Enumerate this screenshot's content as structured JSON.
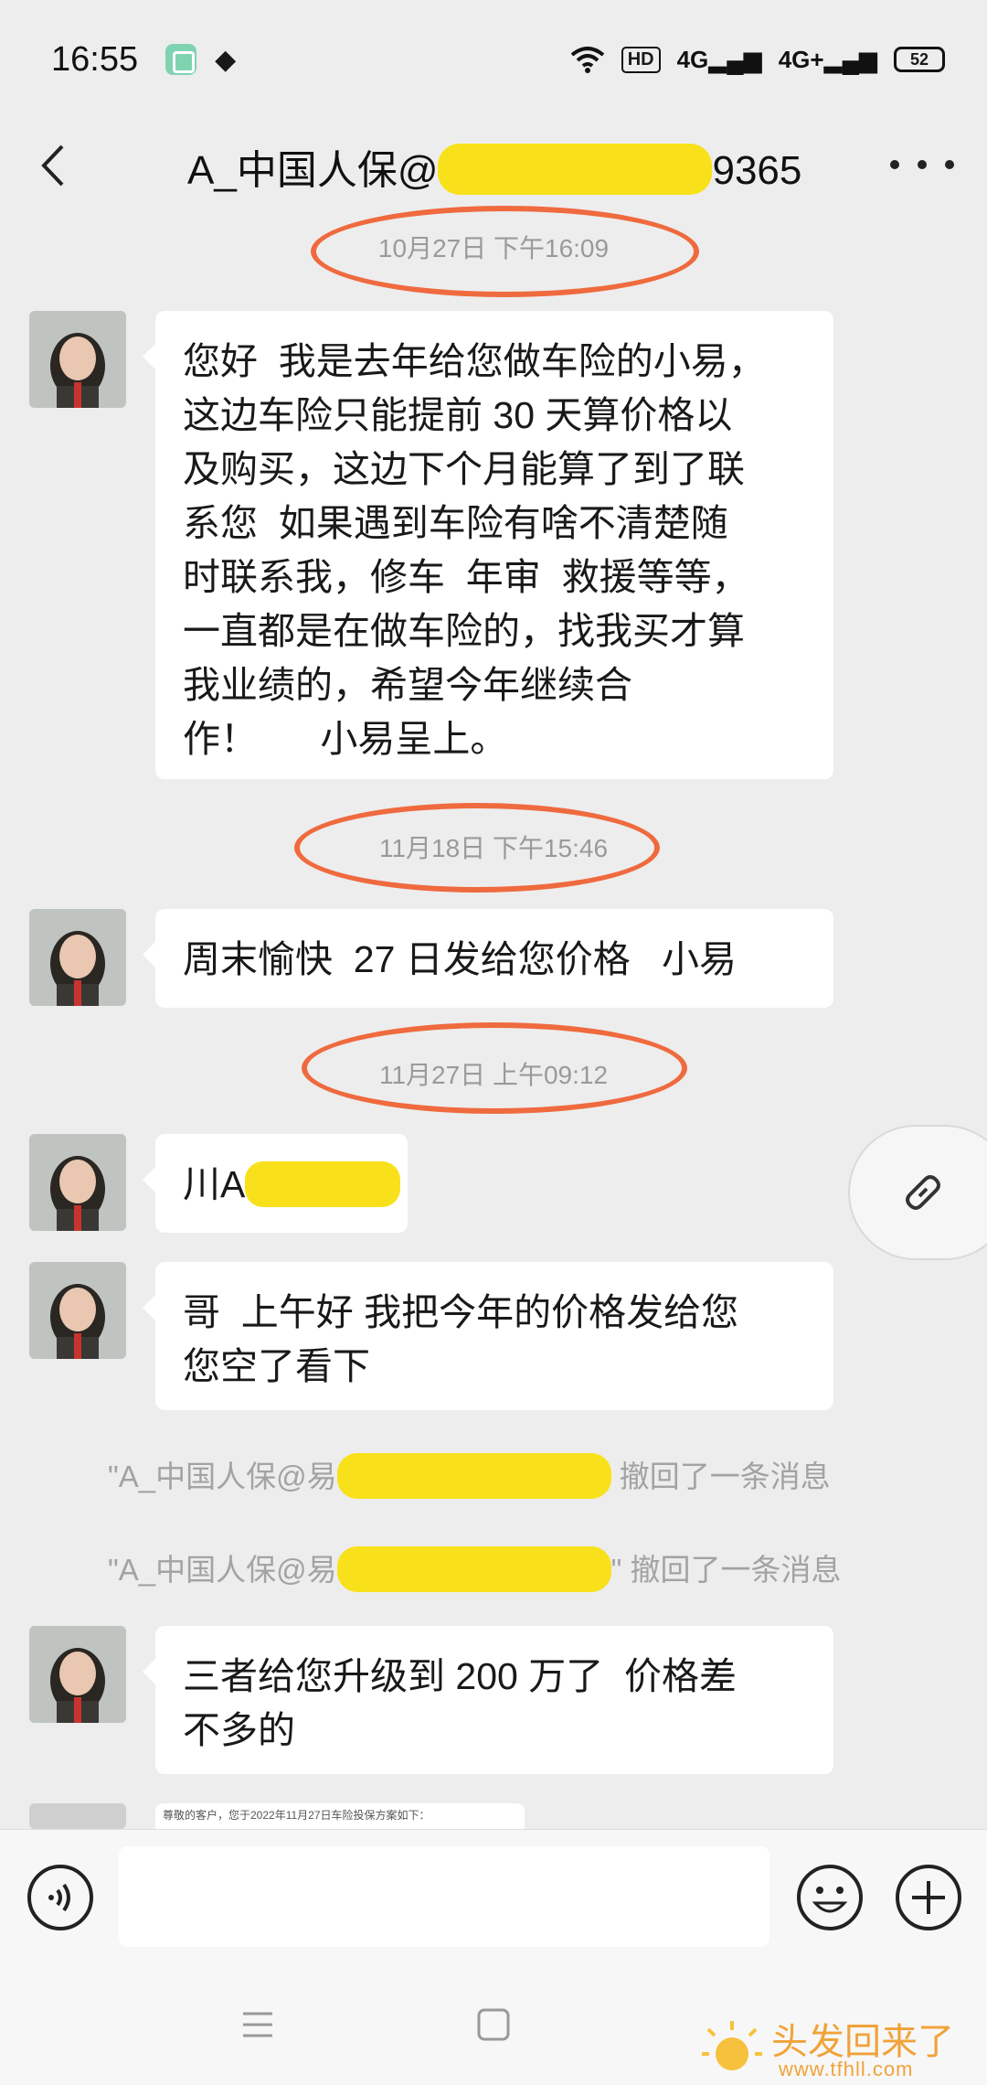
{
  "status_bar": {
    "time": "16:55",
    "signal_label_1": "4G",
    "signal_label_2": "4G+",
    "hd_label": "HD",
    "battery": "52"
  },
  "header": {
    "title_prefix": "A_中国人保@",
    "title_suffix": "9365"
  },
  "messages": {
    "ts1": "10月27日 下午16:09",
    "m1": "您好  我是去年给您做车险的小易，\n这边车险只能提前 30 天算价格以\n及购买，这边下个月能算了到了联\n系您  如果遇到车险有啥不清楚随\n时联系我，修车  年审  救援等等，\n一直都是在做车险的，找我买才算\n我业绩的，希望今年继续合\n作！      小易呈上。",
    "ts2": "11月18日 下午15:46",
    "m2": "周末愉快  27 日发给您价格   小易",
    "ts3": "11月27日 上午09:12",
    "m3_prefix": "川A",
    "m4": "哥  上午好 我把今年的价格发给您\n您空了看下",
    "recall1_prefix": "\"A_中国人保@易",
    "recall1_suffix": " 撤回了一条消息",
    "recall2_prefix": "\"A_中国人保@易",
    "recall2_suffix": "\" 撤回了一条消息",
    "m5": "三者给您升级到 200 万了  价格差\n不多的",
    "doc_preview": "尊敬的客户，您于2022年11月27日车险投保方案如下："
  },
  "input": {
    "placeholder": ""
  },
  "watermark": {
    "text": "头发回来了",
    "url": "www.tfhll.com"
  },
  "colors": {
    "background": "#ededed",
    "bubble": "#ffffff",
    "annotation": "#ef6a3e",
    "redaction": "#f8e11a"
  }
}
